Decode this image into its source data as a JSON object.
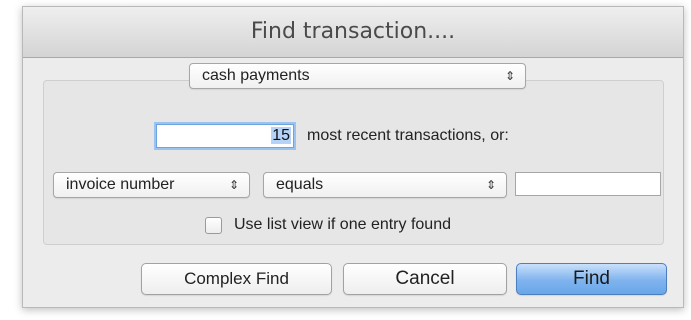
{
  "dialog": {
    "title": "Find transaction...."
  },
  "transaction_type": {
    "selected": "cash payments",
    "arrows": "⇕"
  },
  "count": {
    "value": "15",
    "label": "most recent transactions, or:"
  },
  "criteria": {
    "field_selected": "invoice number",
    "operator_selected": "equals",
    "value": "",
    "arrows": "⇕"
  },
  "list_view": {
    "label": "Use list view if one entry found",
    "checked": false
  },
  "buttons": {
    "complex_find": "Complex Find",
    "cancel": "Cancel",
    "find": "Find"
  }
}
